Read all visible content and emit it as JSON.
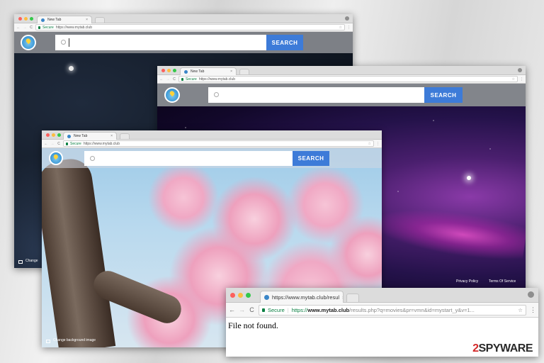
{
  "window1": {
    "tab_title": "New Tab",
    "secure_label": "Secure",
    "url": "https://www.mytab.club",
    "search_button": "SEARCH",
    "footer_left": "Change"
  },
  "window2": {
    "tab_title": "New Tab",
    "secure_label": "Secure",
    "url": "https://www.mytab.club",
    "search_button": "SEARCH",
    "privacy_policy": "Privacy Policy",
    "terms": "Terms Of Service"
  },
  "window3": {
    "tab_title": "New Tab",
    "secure_label": "Secure",
    "url": "https://www.mytab.club",
    "search_button": "SEARCH",
    "change_bg": "Change background image"
  },
  "window4": {
    "tab_title": "https://www.mytab.club/resul",
    "secure_label": "Secure",
    "url_scheme": "https://",
    "url_host": "www.mytab.club",
    "url_path": "/results.php?q=movies&pr=vmn&id=mystart_y&v=1...",
    "body_text": "File not found."
  },
  "watermark": {
    "brand_num": "2",
    "brand_word": "SPYWARE"
  },
  "colors": {
    "search_blue": "#3d7bd8",
    "secure_green": "#0b8043"
  }
}
